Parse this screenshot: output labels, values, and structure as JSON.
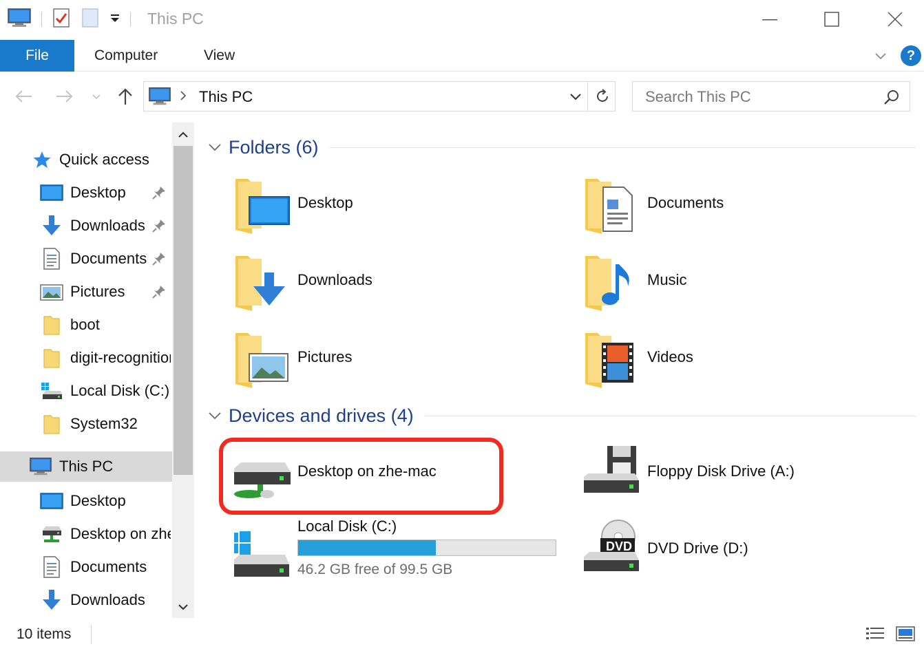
{
  "window": {
    "title": "This PC"
  },
  "ribbon": {
    "tabs": [
      {
        "label": "File"
      },
      {
        "label": "Computer"
      },
      {
        "label": "View"
      }
    ],
    "help_label": "?"
  },
  "address": {
    "path_label": "This PC",
    "search_placeholder": "Search This PC"
  },
  "nav_pane": {
    "items": [
      {
        "label": "Quick access",
        "icon": "star-icon"
      },
      {
        "label": "Desktop",
        "icon": "desktop-icon",
        "pinned": true
      },
      {
        "label": "Downloads",
        "icon": "download-arrow-icon",
        "pinned": true
      },
      {
        "label": "Documents",
        "icon": "document-icon",
        "pinned": true
      },
      {
        "label": "Pictures",
        "icon": "pictures-icon",
        "pinned": true
      },
      {
        "label": "boot",
        "icon": "folder-icon"
      },
      {
        "label": "digit-recognition",
        "icon": "folder-icon"
      },
      {
        "label": "Local Disk (C:)",
        "icon": "local-disk-icon"
      },
      {
        "label": "System32",
        "icon": "folder-icon"
      },
      {
        "label": "This PC",
        "icon": "computer-icon",
        "selected": true
      },
      {
        "label": "Desktop",
        "icon": "desktop-icon"
      },
      {
        "label": "Desktop on zhe-mac",
        "icon": "network-drive-icon"
      },
      {
        "label": "Documents",
        "icon": "document-icon"
      },
      {
        "label": "Downloads",
        "icon": "download-arrow-icon"
      }
    ]
  },
  "groups": {
    "folders": {
      "title": "Folders (6)",
      "items": [
        {
          "label": "Desktop",
          "icon": "desktop-folder-icon"
        },
        {
          "label": "Documents",
          "icon": "documents-folder-icon"
        },
        {
          "label": "Downloads",
          "icon": "downloads-folder-icon"
        },
        {
          "label": "Music",
          "icon": "music-folder-icon"
        },
        {
          "label": "Pictures",
          "icon": "pictures-folder-icon"
        },
        {
          "label": "Videos",
          "icon": "videos-folder-icon"
        }
      ]
    },
    "devices": {
      "title": "Devices and drives (4)",
      "items": [
        {
          "label": "Desktop on zhe-mac",
          "icon": "network-drive-icon"
        },
        {
          "label": "Floppy Disk Drive (A:)",
          "icon": "floppy-drive-icon"
        },
        {
          "label": "Local Disk (C:)",
          "icon": "windows-drive-icon",
          "free_text": "46.2 GB free of 99.5 GB",
          "used_fraction": 0.536
        },
        {
          "label": "DVD Drive (D:)",
          "icon": "dvd-drive-icon",
          "badge": "DVD"
        }
      ]
    }
  },
  "status": {
    "items_count": "10 items"
  },
  "colors": {
    "accent": "#1979ca",
    "group_title": "#1e3f8f",
    "highlight": "#f2291f",
    "drive_fill": "#26a0da"
  }
}
